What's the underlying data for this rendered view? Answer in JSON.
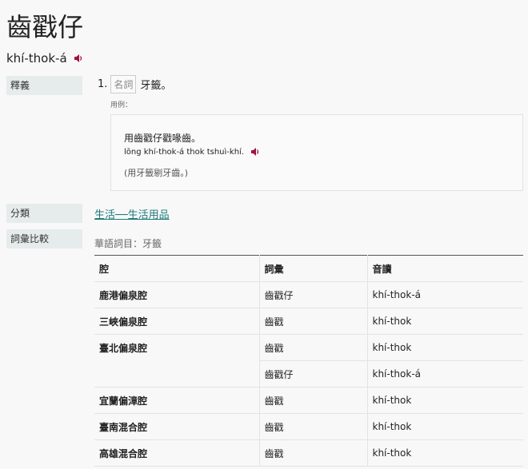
{
  "entry": {
    "title": "齒戳仔",
    "romanization": "khí-thok-á"
  },
  "labels": {
    "definition": "釋義",
    "category": "分類",
    "comparison": "詞彙比較"
  },
  "sense": {
    "number": "1.",
    "pos": "名詞",
    "meaning": "牙籤。",
    "example_label": "用例：",
    "example": {
      "hanji": "用齒戳仔戳喙齒。",
      "lomaji": "lōng khí-thok-á thok tshuì-khí.",
      "translation": "(用牙籤剔牙齒。)"
    }
  },
  "category": {
    "link": "生活──生活用品"
  },
  "comparison": {
    "title": "華語詞目：牙籤",
    "headers": [
      "腔",
      "詞彙",
      "音讀"
    ],
    "rows": [
      {
        "accent": "鹿港偏泉腔",
        "word": "齒戳仔",
        "reading": "khí-thok-á"
      },
      {
        "accent": "三峽偏泉腔",
        "word": "齒戳",
        "reading": "khí-thok"
      },
      {
        "accent": "臺北偏泉腔",
        "word": "齒戳",
        "reading": "khí-thok"
      },
      {
        "accent": "",
        "word": "齒戳仔",
        "reading": "khí-thok-á"
      },
      {
        "accent": "宜蘭偏漳腔",
        "word": "齒戳",
        "reading": "khí-thok"
      },
      {
        "accent": "臺南混合腔",
        "word": "齒戳",
        "reading": "khí-thok"
      },
      {
        "accent": "高雄混合腔",
        "word": "齒戳",
        "reading": "khí-thok"
      }
    ]
  },
  "icons": {
    "audio": "speaker-icon"
  },
  "colors": {
    "audio_icon": "#a0143c",
    "link": "#1f7a7a",
    "label_bg": "#e6ecec"
  }
}
